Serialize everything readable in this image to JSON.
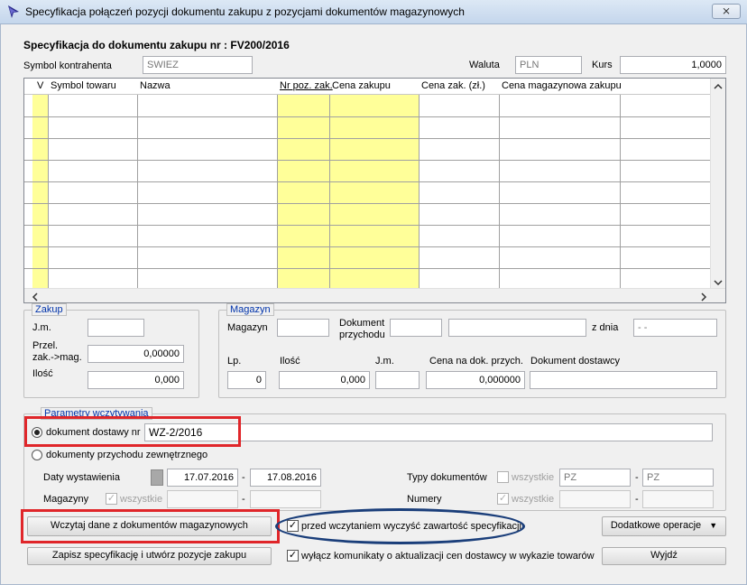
{
  "window": {
    "title": "Specyfikacja połączeń pozycji dokumentu zakupu z pozycjami dokumentów magazynowych",
    "close_glyph": "⨯"
  },
  "header": {
    "spec_title": "Specyfikacja do dokumentu zakupu nr : FV200/2016",
    "symbol_label": "Symbol kontrahenta",
    "symbol_value": "SWIEZ",
    "waluta_label": "Waluta",
    "waluta_value": "PLN",
    "kurs_label": "Kurs",
    "kurs_value": "1,0000"
  },
  "grid": {
    "columns": [
      "V",
      "Symbol towaru",
      "Nazwa",
      "Nr poz. zak.",
      "Cena zakupu",
      "Cena zak. (zł.)",
      "Cena magazynowa zakupu"
    ],
    "accent_yellow": "#ffff99"
  },
  "zakup": {
    "title": "Zakup",
    "jm_label": "J.m.",
    "jm_value": "",
    "przel_label_1": "Przel.",
    "przel_label_2": "zak.->mag.",
    "przel_value": "0,00000",
    "ilosc_label": "Ilość",
    "ilosc_value": "0,000"
  },
  "magazyn": {
    "title": "Magazyn",
    "magazyn_label": "Magazyn",
    "dok_label_1": "Dokument",
    "dok_label_2": "przychodu",
    "zdnia_label": "z dnia",
    "zdnia_value": "  -  -",
    "lp_label": "Lp.",
    "lp_value": "0",
    "ilosc_label": "Ilość",
    "ilosc_value": "0,000",
    "jm_label": "J.m.",
    "cena_label": "Cena na dok. przych.",
    "cena_value": "0,000000",
    "dostawcy_label": "Dokument dostawcy"
  },
  "params": {
    "title": "Parametry wczytywania",
    "radio_dostawy_label": "dokument dostawy nr",
    "dostawy_value": "WZ-2/2016",
    "radio_przychodu_label": "dokumenty przychodu zewnętrznego",
    "daty_label": "Daty wystawienia",
    "date_from": "17.07.2016",
    "date_sep": "-",
    "date_to": "17.08.2016",
    "magazyny_label": "Magazyny",
    "wszystkie_label": "wszystkie",
    "typy_label": "Typy dokumentów",
    "typ_from": "PZ",
    "typ_sep": "-",
    "typ_to": "PZ",
    "numery_label": "Numery",
    "numery_sep": "-"
  },
  "actions": {
    "wczytaj_label": "Wczytaj dane z dokumentów magazynowych",
    "wyczysc_label": "przed wczytaniem wyczyść zawartość specyfikacji",
    "dodatkowe_label": "Dodatkowe operacje",
    "dropdown_glyph": "▼",
    "zapisz_label": "Zapisz specyfikację i utwórz pozycje zakupu",
    "wylacz_label": "wyłącz komunikaty o aktualizacji cen dostawcy w wykazie towarów",
    "wyjdz_label": "Wyjdź",
    "check_glyph": "✓"
  },
  "colors": {
    "annotation_red": "#e0262a",
    "annotation_blue": "#1a3e7a"
  }
}
